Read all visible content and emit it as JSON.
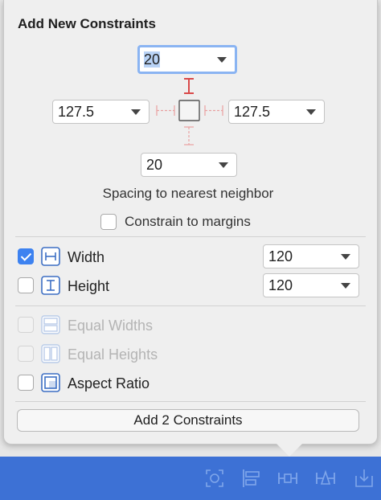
{
  "popover": {
    "title": "Add New Constraints",
    "spacing": {
      "top": "20",
      "left": "127.5",
      "right": "127.5",
      "bottom": "20",
      "caption": "Spacing to nearest neighbor"
    },
    "constrain_to_margins": {
      "label": "Constrain to margins",
      "checked": false
    },
    "width": {
      "label": "Width",
      "checked": true,
      "value": "120"
    },
    "height": {
      "label": "Height",
      "checked": false,
      "value": "120"
    },
    "equal_widths": {
      "label": "Equal Widths",
      "enabled": false
    },
    "equal_heights": {
      "label": "Equal Heights",
      "enabled": false
    },
    "aspect_ratio": {
      "label": "Aspect Ratio",
      "checked": false
    },
    "add_button": "Add 2 Constraints"
  },
  "toolbar": {
    "icons": [
      "update-frames-icon",
      "align-icon",
      "add-constraints-icon",
      "resolve-issues-icon",
      "embed-in-icon"
    ]
  },
  "colors": {
    "accent": "#3d82f0",
    "toolbar": "#3d71d5",
    "strut_active": "#d94a4a",
    "strut_inactive": "#e9a0a0"
  }
}
